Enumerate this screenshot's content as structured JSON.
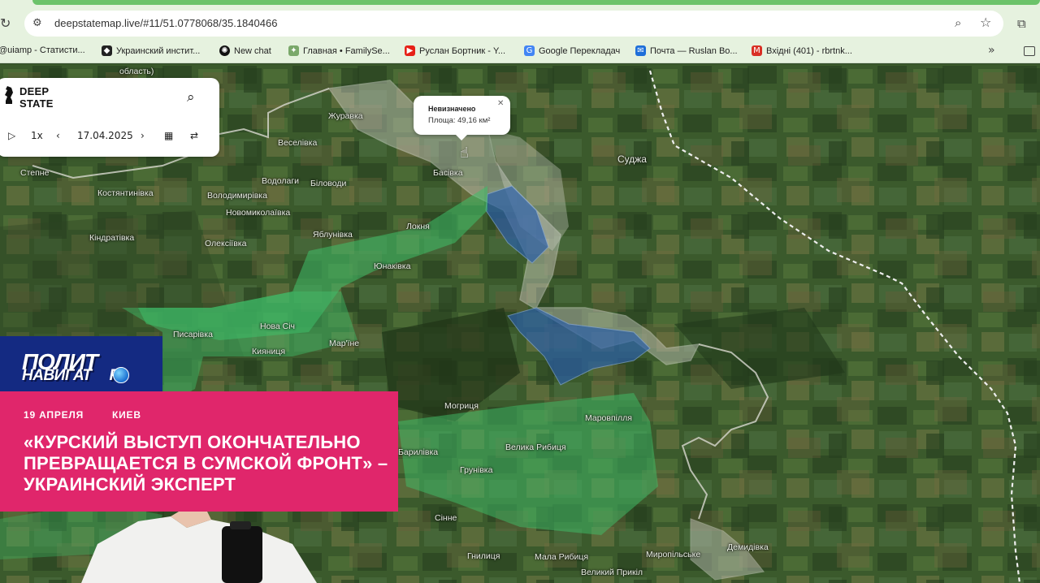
{
  "browser": {
    "url": "deepstatemap.live/#11/51.0778068/35.1840466",
    "bookmarks": [
      {
        "label": "@uiamp - Статисти...",
        "icon_color": "#6a6a6a"
      },
      {
        "label": "Украинский инстит...",
        "icon_color": "#222222"
      },
      {
        "label": "New chat",
        "icon_color": "#111111"
      },
      {
        "label": "Главная • FamilySe...",
        "icon_color": "#7aa86a"
      },
      {
        "label": "Руслан Бортник - Y...",
        "icon_color": "#e62117"
      },
      {
        "label": "Google Перекладач",
        "icon_color": "#4285f4"
      },
      {
        "label": "Почта — Ruslan Bo...",
        "icon_color": "#1e6fd9"
      },
      {
        "label": "Вхідні (401) - rbrtnk...",
        "icon_color": "#d93025"
      }
    ]
  },
  "deepstate": {
    "brand_line1": "DEEP",
    "brand_line2": "STATE",
    "speed": "1x",
    "date": "17.04.2025"
  },
  "popup": {
    "title": "Невизначено",
    "area": "Площа: 49,16 км²"
  },
  "places": [
    {
      "name": "Журавка"
    },
    {
      "name": "Веселівка"
    },
    {
      "name": "Степне"
    },
    {
      "name": "Костянтинівка"
    },
    {
      "name": "Водолаги"
    },
    {
      "name": "Біловоди"
    },
    {
      "name": "Володимирівка"
    },
    {
      "name": "Новомиколаївка"
    },
    {
      "name": "Басівка"
    },
    {
      "name": "Суджа"
    },
    {
      "name": "Локня"
    },
    {
      "name": "Яблунівка"
    },
    {
      "name": "Кіндратівка"
    },
    {
      "name": "Олексіївка"
    },
    {
      "name": "Юнаківка"
    },
    {
      "name": "Писарівка"
    },
    {
      "name": "Нова Січ"
    },
    {
      "name": "Кияниця"
    },
    {
      "name": "Мар'їне"
    },
    {
      "name": "Могриця"
    },
    {
      "name": "Маровпілля"
    },
    {
      "name": "Велика Рибиця"
    },
    {
      "name": "Барилівка"
    },
    {
      "name": "Грунівка"
    },
    {
      "name": "Сінне"
    },
    {
      "name": "Гнилиця"
    },
    {
      "name": "Мала Рибиця"
    },
    {
      "name": "Миропільське"
    },
    {
      "name": "Демидівка"
    },
    {
      "name": "Великий Прикіл"
    },
    {
      "name": "область)"
    }
  ],
  "news": {
    "logo_line1": "ПОЛИТ",
    "logo_line2": "НАВИГАТ",
    "logo_line2_end": "Р",
    "date": "19 АПРЕЛЯ",
    "city": "КИЕВ",
    "headline": "«КУРСКИЙ ВЫСТУП ОКОНЧАТЕЛЬНО ПРЕВРАЩАЕТСЯ В СУМСКОЙ ФРОНТ» – УКРАИНСКИЙ ЭКСПЕРТ"
  },
  "colors": {
    "browser_bg": "#e6f2df",
    "accent_green": "#6cc36a",
    "liberated_green": "#3fbf6a",
    "occupied_blue": "#2b5fa8",
    "grey_zone": "#cfcfcf",
    "news_red": "#e0266b",
    "news_blue": "#142a82"
  }
}
